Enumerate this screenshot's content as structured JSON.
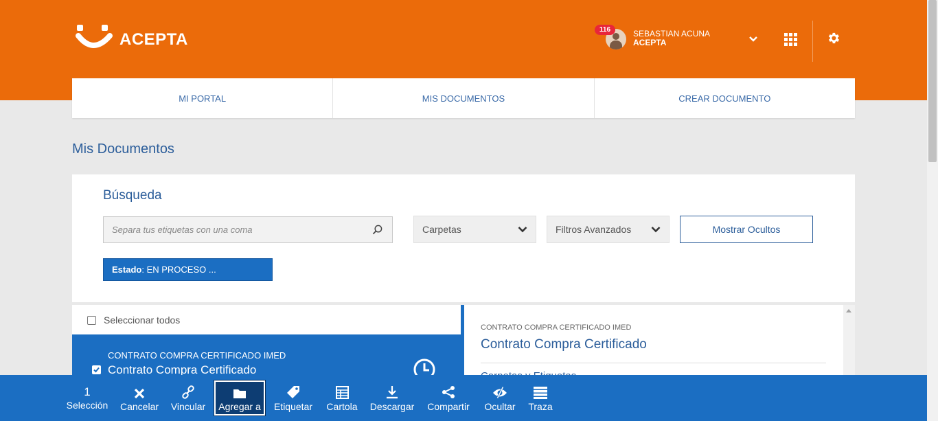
{
  "header": {
    "brand": "ACEPTA",
    "notifications": "116",
    "user_name": "SEBASTIAN ACUNA",
    "user_org": "ACEPTA",
    "colors": {
      "primary": "#eb6b0a",
      "accent": "#1b6ec2"
    },
    "icons": [
      "acepta-logo-icon",
      "avatar",
      "chevron-down-icon",
      "apps-grid-icon",
      "gear-icon"
    ]
  },
  "nav": {
    "items": [
      "MI PORTAL",
      "MIS DOCUMENTOS",
      "CREAR DOCUMENTO"
    ]
  },
  "page": {
    "title": "Mis Documentos"
  },
  "search": {
    "title": "Búsqueda",
    "tags_placeholder": "Separa tus etiquetas con una coma",
    "folders_label": "Carpetas",
    "filters_label": "Filtros Avanzados",
    "show_hidden_label": "Mostrar Ocultos",
    "estado_key": "Estado",
    "estado_value": ": EN PROCESO ..."
  },
  "list": {
    "select_all_label": "Seleccionar todos",
    "items": [
      {
        "type": "CONTRATO COMPRA CERTIFICADO IMED",
        "title": "Contrato Compra Certificado",
        "checked": true,
        "icon": "clock-icon"
      }
    ]
  },
  "detail": {
    "type": "CONTRATO COMPRA CERTIFICADO IMED",
    "title": "Contrato Compra Certificado",
    "section": "Carpetas y Etiquetas"
  },
  "toolbar": {
    "selection_count": "1",
    "selection_label": "Selección",
    "cancel": "Cancelar",
    "link": "Vincular",
    "add_to": "Agregar a",
    "tag": "Etiquetar",
    "cartola": "Cartola",
    "download": "Descargar",
    "share": "Compartir",
    "hide": "Ocultar",
    "trace": "Traza"
  }
}
